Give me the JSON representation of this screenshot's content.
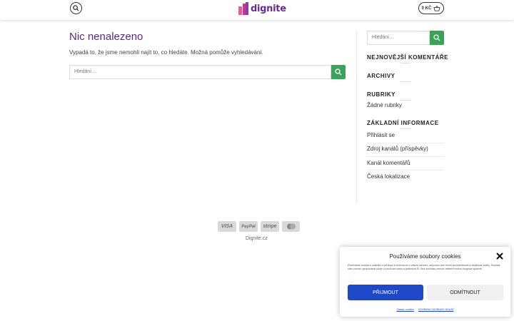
{
  "header": {
    "logo_text": "dignite",
    "cart_label": "0 KČ"
  },
  "main": {
    "title": "Nic nenalezeno",
    "intro": "Vypadá to, že jsme nemohli najít to, co hledáte. Možná pomůže vyhledávání.",
    "search_placeholder": "Hledání…"
  },
  "sidebar": {
    "search_placeholder": "Hledání…",
    "widgets": {
      "recent_comments": "NEJNOVĚJŠÍ KOMENTÁŘE",
      "archives": "ARCHIVY",
      "categories": "RUBRIKY",
      "categories_empty": "Žádné rubriky",
      "meta": "ZÁKLADNÍ INFORMACE"
    },
    "meta_links": [
      "Přihlásit se",
      "Zdroj kanálů (příspěvky)",
      "Kanál komentářů",
      "Česká lokalizace"
    ]
  },
  "footer": {
    "payments": [
      "VISA",
      "PayPal",
      "stripe",
      "mastercard"
    ],
    "copyright": "Dignite.cz"
  },
  "cookie": {
    "title": "Používáme soubory cookies",
    "text": "Používáme cookies k ukládání a přístupu k informacím o vašem zařízení, abychom vám mohli zprostředkovat a zlepšovat služby. Souhlas nám umožní zpracovávat údaje o používání webu a jedinečná ID. Bez souhlasu nemusí některé funkce fungovat správně.",
    "accept": "PŘIJMOUT",
    "deny": "ODMÍTNOUT",
    "links": [
      "Zásady cookies",
      "OCHRANA OSOBNÍCH ÚDAJŮ"
    ]
  },
  "colors": {
    "accent_green": "#3aa35a",
    "title_purple": "#5b2a86",
    "accept_blue": "#1e48c8"
  }
}
